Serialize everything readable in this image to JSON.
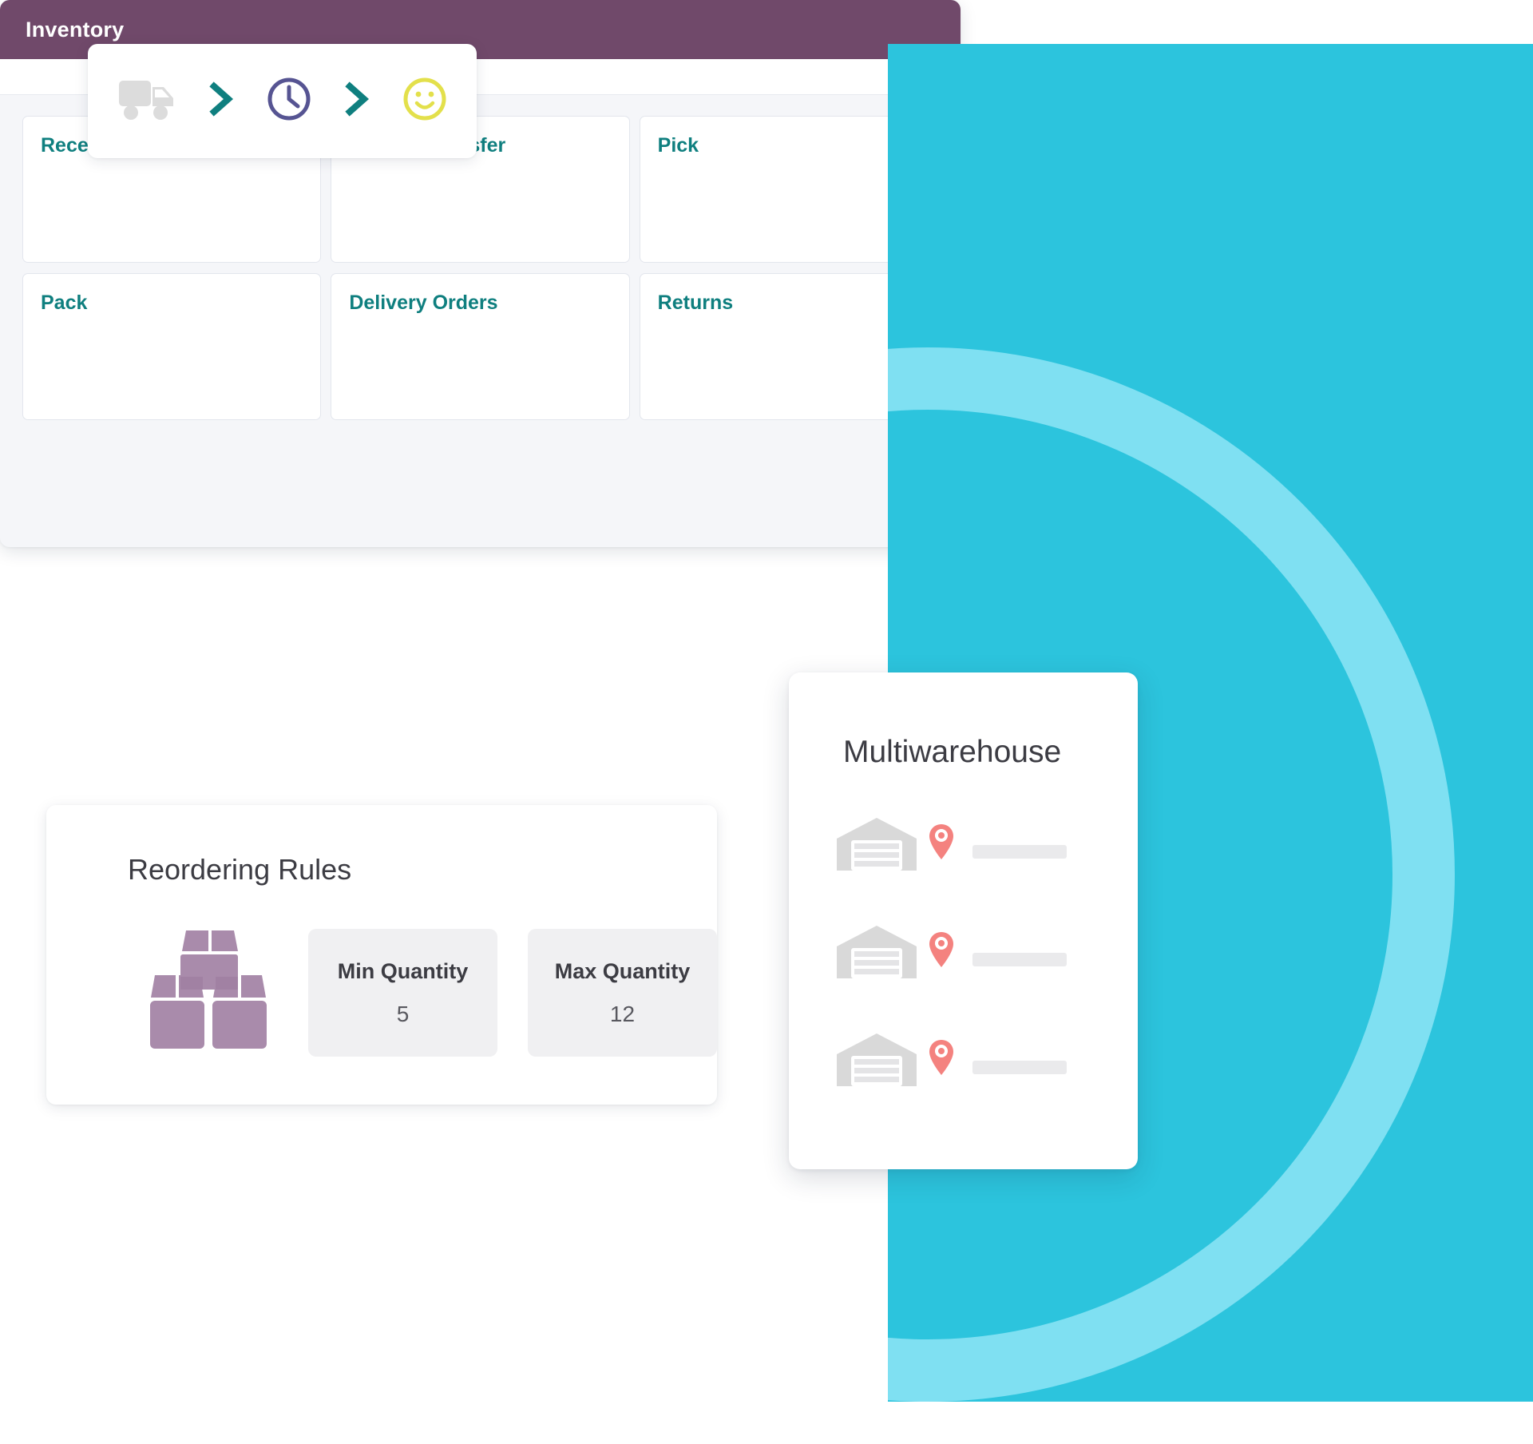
{
  "colors": {
    "teal_panel": "#2cc4dd",
    "teal_arc": "#7fe0f2",
    "inventory_header": "#70496a",
    "tile_label": "#0f7f7f",
    "chevron": "#0f7f7f",
    "clock": "#565492",
    "smiley": "#e3e04b",
    "truck": "#dcdcdc",
    "box_icon": "#a98bab",
    "map_pin": "#f4827f",
    "warehouse": "#d9d9d9"
  },
  "flow_card": {
    "steps": [
      {
        "icon": "truck-icon",
        "name": "delivery-truck"
      },
      {
        "icon": "chevron-right-icon",
        "name": "chevron-1"
      },
      {
        "icon": "clock-icon",
        "name": "lead-time"
      },
      {
        "icon": "chevron-right-icon",
        "name": "chevron-2"
      },
      {
        "icon": "smiley-face-icon",
        "name": "customer-satisfaction"
      }
    ]
  },
  "inventory_window": {
    "title": "Inventory",
    "tiles": [
      {
        "label": "Receipts"
      },
      {
        "label": "Internal Transfer"
      },
      {
        "label": "Pick"
      },
      {
        "label": "Pack"
      },
      {
        "label": "Delivery Orders"
      },
      {
        "label": "Returns"
      }
    ]
  },
  "reordering_rules": {
    "title": "Reordering Rules",
    "icon": "stacked-boxes-icon",
    "fields": [
      {
        "label": "Min Quantity",
        "value": "5"
      },
      {
        "label": "Max Quantity",
        "value": "12"
      }
    ]
  },
  "multiwarehouse": {
    "title": "Multiwarehouse",
    "rows": [
      {
        "warehouse_icon": "warehouse-icon",
        "pin_icon": "map-pin-icon",
        "name_placeholder": ""
      },
      {
        "warehouse_icon": "warehouse-icon",
        "pin_icon": "map-pin-icon",
        "name_placeholder": ""
      },
      {
        "warehouse_icon": "warehouse-icon",
        "pin_icon": "map-pin-icon",
        "name_placeholder": ""
      }
    ]
  }
}
